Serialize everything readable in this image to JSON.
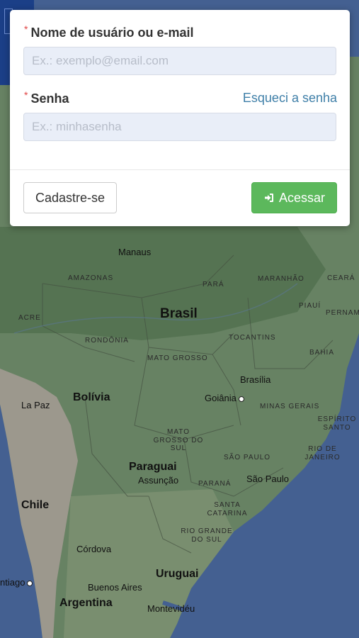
{
  "login": {
    "username_label": "Nome de usuário ou e-mail",
    "username_placeholder": "Ex.: exemplo@email.com",
    "username_value": "",
    "password_label": "Senha",
    "password_placeholder": "Ex.: minhasenha",
    "password_value": "",
    "required_marker": "*",
    "forgot_link": "Esqueci a senha",
    "signup_button": "Cadastre-se",
    "login_button": "Acessar",
    "login_icon": "sign-in-icon"
  },
  "map": {
    "countries": {
      "brasil": "Brasil",
      "bolivia": "Bolívia",
      "paraguai": "Paraguai",
      "chile": "Chile",
      "uruguai": "Uruguai",
      "argentina": "Argentina"
    },
    "states": {
      "amazonas": "AMAZONAS",
      "para": "PARÁ",
      "maranhao": "MARANHÃO",
      "ceara": "CEARÁ",
      "piaui": "PIAUÍ",
      "pernam": "PERNAM",
      "acre": "ACRE",
      "rondonia": "RONDÔNIA",
      "tocantins": "TOCANTINS",
      "bahia": "BAHIA",
      "mato_grosso": "MATO GROSSO",
      "minas_gerais": "MINAS GERAIS",
      "espirito_santo": "ESPÍRITO SANTO",
      "mato_grosso_do_sul": "MATO GROSSO DO SUL",
      "sao_paulo_state": "SÃO PAULO",
      "rio_de_janeiro": "RIO DE JANEIRO",
      "parana": "PARANÁ",
      "santa_catarina": "SANTA CATARINA",
      "rio_grande_do_sul": "RIO GRANDE DO SUL"
    },
    "cities": {
      "manaus": "Manaus",
      "brasilia": "Brasília",
      "goiania": "Goiânia",
      "la_paz": "La Paz",
      "assuncao": "Assunção",
      "sao_paulo": "São Paulo",
      "cordova": "Córdova",
      "santiago": "ntiago",
      "buenos_aires": "Buenos Aires",
      "montevideu": "Montevidéu"
    }
  }
}
